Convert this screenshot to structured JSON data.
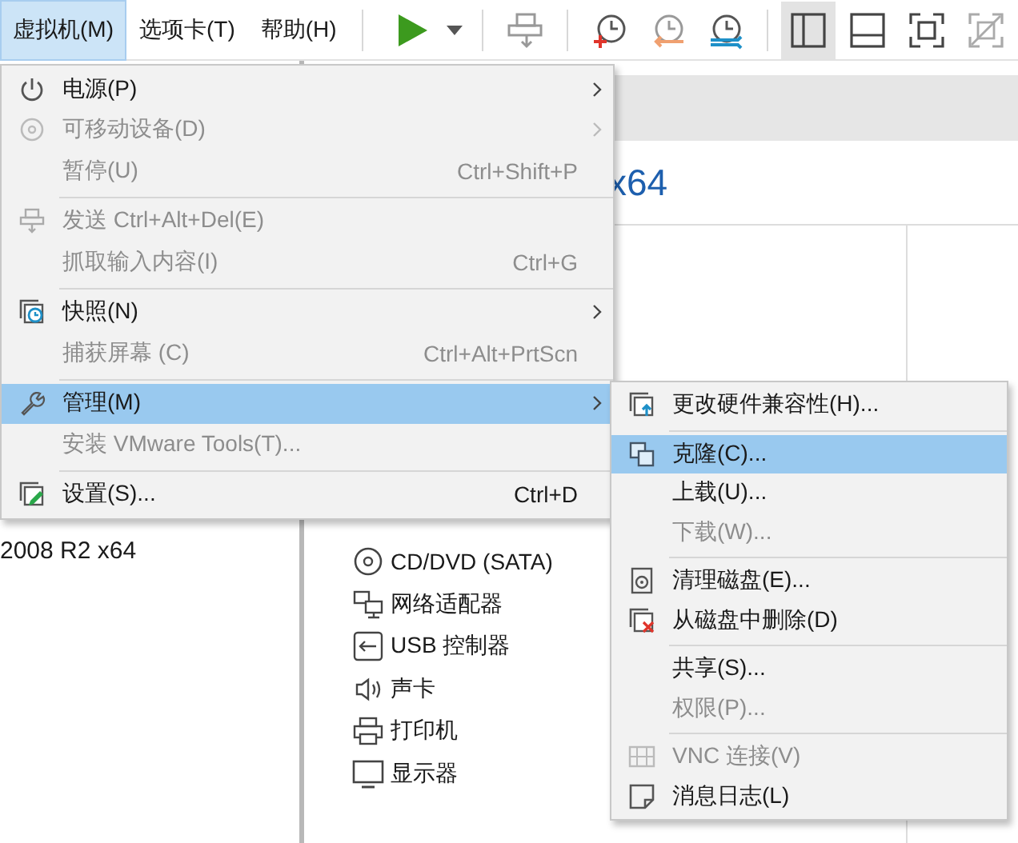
{
  "menubar": [
    {
      "label": "虚拟机(M)",
      "selected": true
    },
    {
      "label": "选项卡(T)",
      "selected": false
    },
    {
      "label": "帮助(H)",
      "selected": false
    }
  ],
  "toolbar": {
    "view_buttons": [
      {
        "selected": true
      },
      {
        "selected": false
      },
      {
        "selected": false
      },
      {
        "selected": false
      }
    ]
  },
  "library": {
    "items": [
      {
        "label": "2008 R2 x64"
      }
    ]
  },
  "vm_title": "x64",
  "devices": [
    {
      "label": "CD/DVD (SATA)"
    },
    {
      "label": "网络适配器"
    },
    {
      "label": "USB 控制器"
    },
    {
      "label": "声卡"
    },
    {
      "label": "打印机"
    },
    {
      "label": "显示器"
    }
  ],
  "menu": {
    "groups": [
      [
        {
          "label": "电源(P)",
          "has_submenu": true,
          "disabled": false,
          "selected": false
        },
        {
          "label": "可移动设备(D)",
          "has_submenu": true,
          "disabled": true,
          "selected": false
        },
        {
          "label": "暂停(U)",
          "shortcut": "Ctrl+Shift+P",
          "has_submenu": false,
          "disabled": true,
          "selected": false
        }
      ],
      [
        {
          "label": "发送 Ctrl+Alt+Del(E)",
          "has_submenu": false,
          "disabled": true,
          "selected": false
        },
        {
          "label": "抓取输入内容(I)",
          "shortcut": "Ctrl+G",
          "has_submenu": false,
          "disabled": true,
          "selected": false
        }
      ],
      [
        {
          "label": "快照(N)",
          "has_submenu": true,
          "disabled": false,
          "selected": false
        },
        {
          "label": "捕获屏幕 (C)",
          "shortcut": "Ctrl+Alt+PrtScn",
          "has_submenu": false,
          "disabled": true,
          "selected": false
        }
      ],
      [
        {
          "label": "管理(M)",
          "has_submenu": true,
          "disabled": false,
          "selected": true
        },
        {
          "label": "安装 VMware Tools(T)...",
          "has_submenu": false,
          "disabled": true,
          "selected": false
        }
      ],
      [
        {
          "label": "设置(S)...",
          "shortcut": "Ctrl+D",
          "has_submenu": false,
          "disabled": false,
          "selected": false
        }
      ]
    ]
  },
  "submenu": {
    "groups": [
      [
        {
          "label": "更改硬件兼容性(H)...",
          "disabled": false,
          "selected": false
        }
      ],
      [
        {
          "label": "克隆(C)...",
          "disabled": false,
          "selected": true
        },
        {
          "label": "上载(U)...",
          "disabled": false,
          "selected": false
        },
        {
          "label": "下载(W)...",
          "disabled": true,
          "selected": false
        }
      ],
      [
        {
          "label": "清理磁盘(E)...",
          "disabled": false,
          "selected": false
        },
        {
          "label": "从磁盘中删除(D)",
          "disabled": false,
          "selected": false
        }
      ],
      [
        {
          "label": "共享(S)...",
          "disabled": false,
          "selected": false
        },
        {
          "label": "权限(P)...",
          "disabled": true,
          "selected": false
        }
      ],
      [
        {
          "label": "VNC 连接(V)",
          "disabled": true,
          "selected": false
        },
        {
          "label": "消息日志(L)",
          "disabled": false,
          "selected": false
        }
      ]
    ]
  }
}
